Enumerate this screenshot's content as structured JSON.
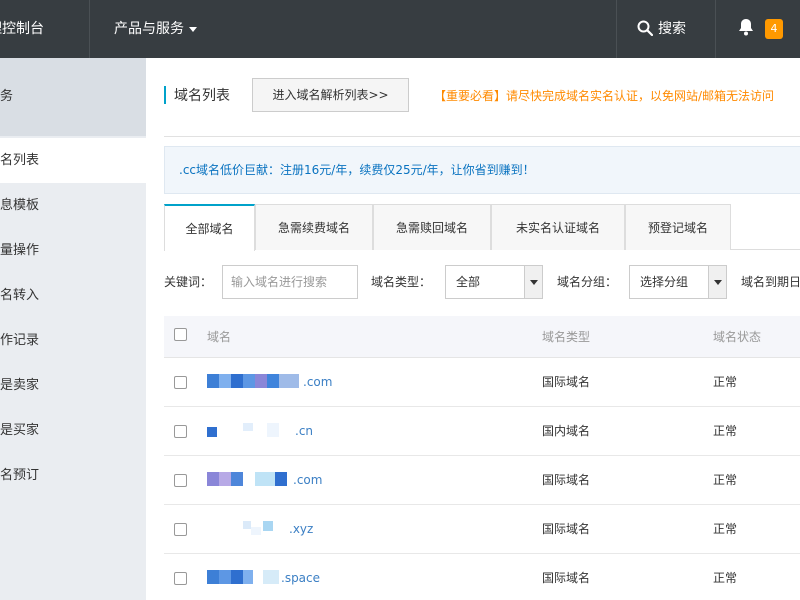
{
  "topbar": {
    "brand": "管理控制台",
    "products": "产品与服务",
    "search": "搜索",
    "badge": "4"
  },
  "sidebar": {
    "header": "服务",
    "items": [
      "域名列表",
      "信息模板",
      "批量操作",
      "域名转入",
      "操作记录",
      "我是卖家",
      "我是买家",
      "域名预订"
    ]
  },
  "main": {
    "title": "域名列表",
    "dns_button": "进入域名解析列表>>",
    "notice": "【重要必看】请尽快完成域名实名认证，以免网站/邮箱无法访问"
  },
  "promo": ".cc域名低价巨献：注册16元/年，续费仅25元/年，让你省到赚到！",
  "tabs": [
    "全部域名",
    "急需续费域名",
    "急需赎回域名",
    "未实名认证域名",
    "预登记域名"
  ],
  "filters": {
    "keyword_label": "关键词：",
    "keyword_placeholder": "输入域名进行搜索",
    "type_label": "域名类型：",
    "type_value": "全部",
    "group_label": "域名分组：",
    "group_value": "选择分组",
    "expire_label": "域名到期日"
  },
  "table": {
    "headers": [
      "域名",
      "域名类型",
      "域名状态"
    ],
    "rows": [
      {
        "suffix": ".com",
        "type": "国际域名",
        "status": "正常"
      },
      {
        "suffix": ".cn",
        "type": "国内域名",
        "status": "正常"
      },
      {
        "suffix": ".com",
        "type": "国际域名",
        "status": "正常"
      },
      {
        "suffix": ".xyz",
        "type": "国际域名",
        "status": "正常"
      },
      {
        "suffix": ".space",
        "type": "国际域名",
        "status": "正常"
      }
    ]
  },
  "colors": {
    "topbar": "#373d41",
    "accent": "#00a2ca",
    "notice": "#ff8a00",
    "badge": "#ff9900",
    "link": "#3b7fc4"
  }
}
